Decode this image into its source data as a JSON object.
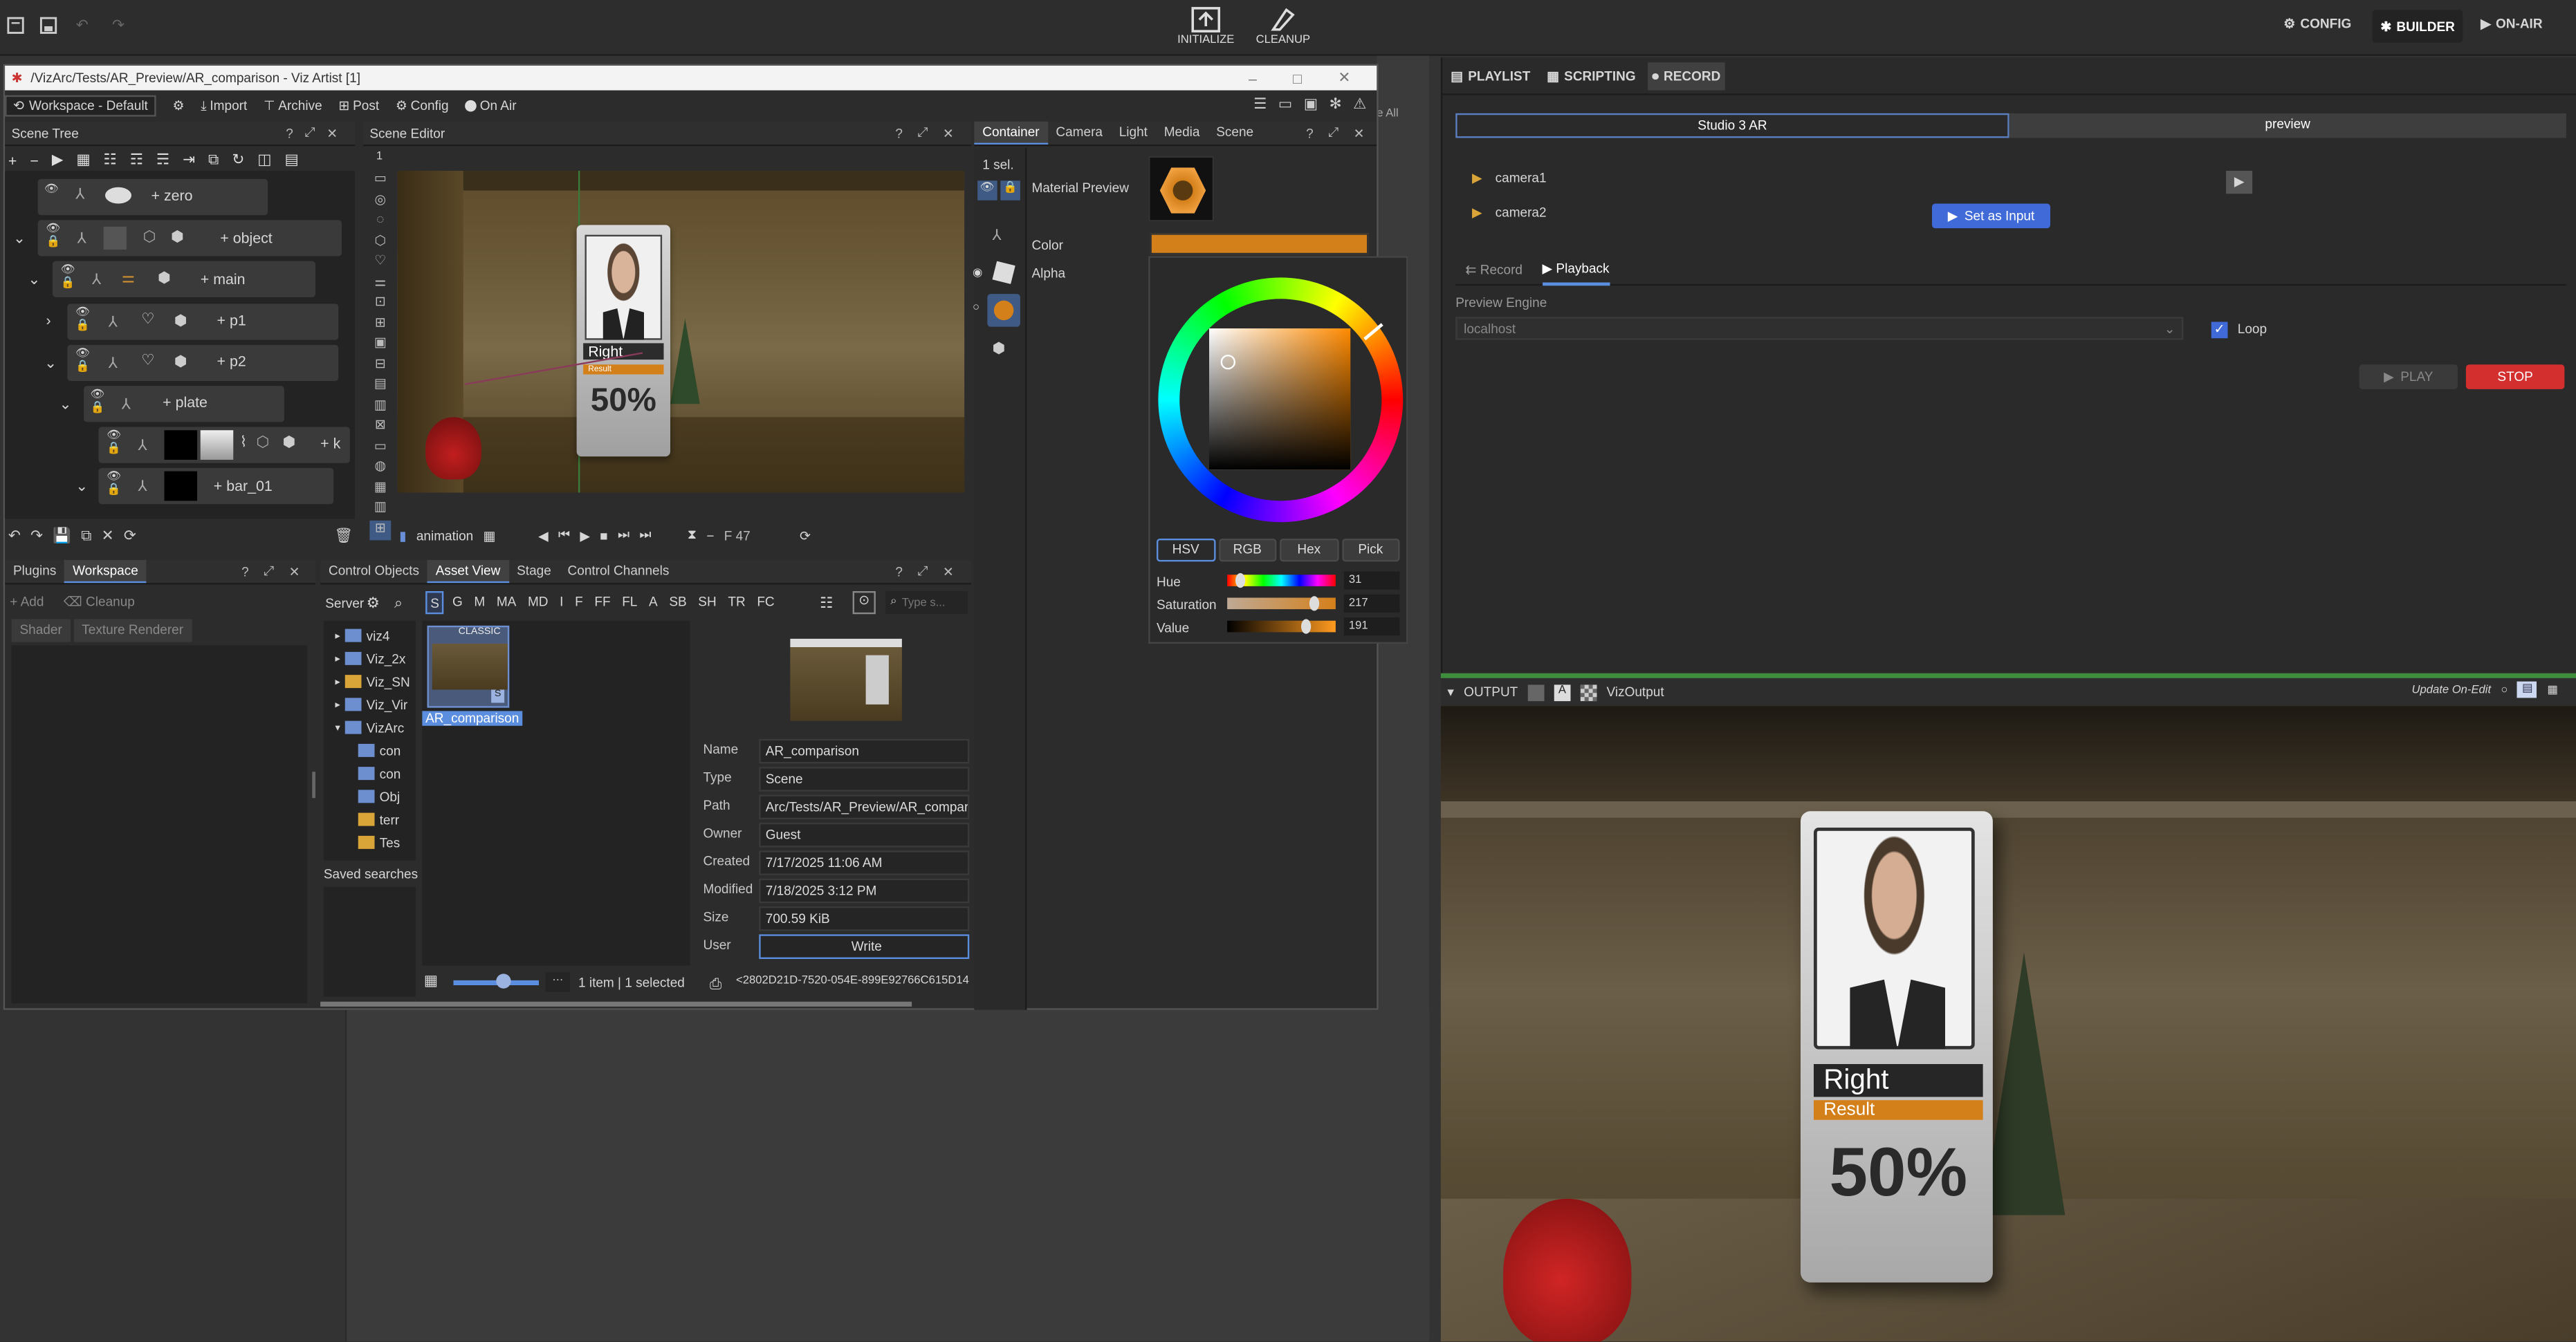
{
  "topbar": {
    "initialize": "INITIALIZE",
    "cleanup": "CLEANUP",
    "config": "CONFIG",
    "builder": "BUILDER",
    "on_air": "ON-AIR"
  },
  "window": {
    "title": "/VizArc/Tests/AR_Preview/AR_comparison - Viz Artist [1]"
  },
  "menu": {
    "workspace": "Workspace - Default",
    "import": "Import",
    "archive": "Archive",
    "post": "Post",
    "config": "Config",
    "on_air": "On Air",
    "all_label": "e All"
  },
  "scene_tree": {
    "title": "Scene Tree",
    "nodes": {
      "zero": "zero",
      "object": "object",
      "main": "main",
      "p1": "p1",
      "p2": "p2",
      "plate": "plate",
      "k": "k",
      "bar": "bar_01"
    }
  },
  "scene_editor": {
    "title": "Scene Editor",
    "side_num": "1",
    "animation": "animation",
    "frame": "F 47",
    "card": {
      "name": "Right",
      "result": "Result",
      "percent": "50%"
    }
  },
  "container": {
    "tabs": [
      "Container",
      "Camera",
      "Light",
      "Media",
      "Scene"
    ],
    "sel": "1 sel.",
    "material_preview": "Material Preview",
    "color_label": "Color",
    "alpha_label": "Alpha",
    "color_hex": "#d4801a"
  },
  "color_picker": {
    "modes": [
      "HSV",
      "RGB",
      "Hex",
      "Pick"
    ],
    "hue_label": "Hue",
    "hue": "31",
    "sat_label": "Saturation",
    "sat": "217",
    "val_label": "Value",
    "val": "191"
  },
  "left_bottom": {
    "tabs": [
      "Plugins",
      "Workspace"
    ],
    "add": "Add",
    "cleanup": "Cleanup",
    "subtabs": [
      "Shader",
      "Texture Renderer"
    ]
  },
  "assets": {
    "tabs": [
      "Control Objects",
      "Asset View",
      "Stage",
      "Control Channels"
    ],
    "server": "Server",
    "filters": [
      "S",
      "G",
      "M",
      "MA",
      "MD",
      "I",
      "F",
      "FF",
      "FL",
      "A",
      "SB",
      "SH",
      "TR",
      "FC"
    ],
    "search_placeholder": "Type s...",
    "tree": [
      "viz4",
      "Viz_2x",
      "Viz_SN",
      "Viz_Vir",
      "VizArc",
      "con",
      "con",
      "Obj",
      "terr",
      "Tes"
    ],
    "saved": "Saved searches",
    "thumb_badge": "CLASSIC",
    "thumb_label": "AR_comparison",
    "status": "1 item | 1 selected",
    "guid": "<2802D21D-7520-054E-899E92766C615D14"
  },
  "props": [
    {
      "k": "Name",
      "v": "AR_comparison"
    },
    {
      "k": "Type",
      "v": "Scene"
    },
    {
      "k": "Path",
      "v": "Arc/Tests/AR_Preview/AR_comparis"
    },
    {
      "k": "Owner",
      "v": "Guest"
    },
    {
      "k": "Created",
      "v": "7/17/2025 11:06 AM"
    },
    {
      "k": "Modified",
      "v": "7/18/2025 3:12 PM"
    },
    {
      "k": "Size",
      "v": "700.59 KiB"
    },
    {
      "k": "User",
      "v": "Write"
    }
  ],
  "right": {
    "tabs": [
      "PLAYLIST",
      "SCRIPTING",
      "RECORD"
    ],
    "studio": "Studio 3 AR",
    "preview": "preview",
    "camera1": "camera1",
    "camera2": "camera2",
    "set_input": "Set as Input",
    "record": "Record",
    "playback": "Playback",
    "engine_label": "Preview Engine",
    "engine": "localhost",
    "loop": "Loop",
    "play": "PLAY",
    "stop": "STOP"
  },
  "output": {
    "label": "OUTPUT",
    "viz": "VizOutput",
    "update": "Update On-Edit",
    "card": {
      "name": "Right",
      "result": "Result",
      "percent": "50%"
    }
  }
}
